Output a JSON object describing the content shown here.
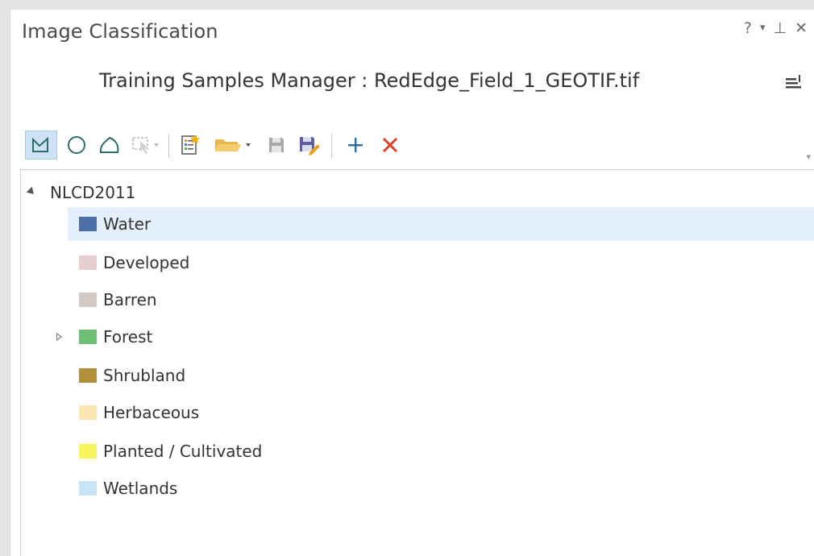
{
  "pane": {
    "title": "Image Classification",
    "controls": {
      "help": "?",
      "options": "▾",
      "pin": "⊥",
      "close": "✕"
    }
  },
  "manager": {
    "title": "Training Samples Manager : RedEdge_Field_1_GEOTIF.tif"
  },
  "toolbar": {
    "icons": [
      "rectangle-icon",
      "circle-icon",
      "polygon-icon",
      "select-icon",
      "new-schema-icon",
      "open-folder-icon",
      "save-icon",
      "save-as-icon",
      "add-class-icon",
      "remove-class-icon"
    ]
  },
  "tree": {
    "root": {
      "label": "NLCD2011"
    },
    "items": [
      {
        "label": "Water",
        "color": "#4c6ea6",
        "selected": true,
        "expandable": false
      },
      {
        "label": "Developed",
        "color": "#e6cfd1",
        "selected": false,
        "expandable": false
      },
      {
        "label": "Barren",
        "color": "#d2cac2",
        "selected": false,
        "expandable": false
      },
      {
        "label": "Forest",
        "color": "#6fbe76",
        "selected": false,
        "expandable": true
      },
      {
        "label": "Shrubland",
        "color": "#b0913a",
        "selected": false,
        "expandable": false
      },
      {
        "label": "Herbaceous",
        "color": "#fbe6b1",
        "selected": false,
        "expandable": false
      },
      {
        "label": "Planted / Cultivated",
        "color": "#f7f45c",
        "selected": false,
        "expandable": false
      },
      {
        "label": "Wetlands",
        "color": "#c8e4f7",
        "selected": false,
        "expandable": false
      }
    ]
  }
}
